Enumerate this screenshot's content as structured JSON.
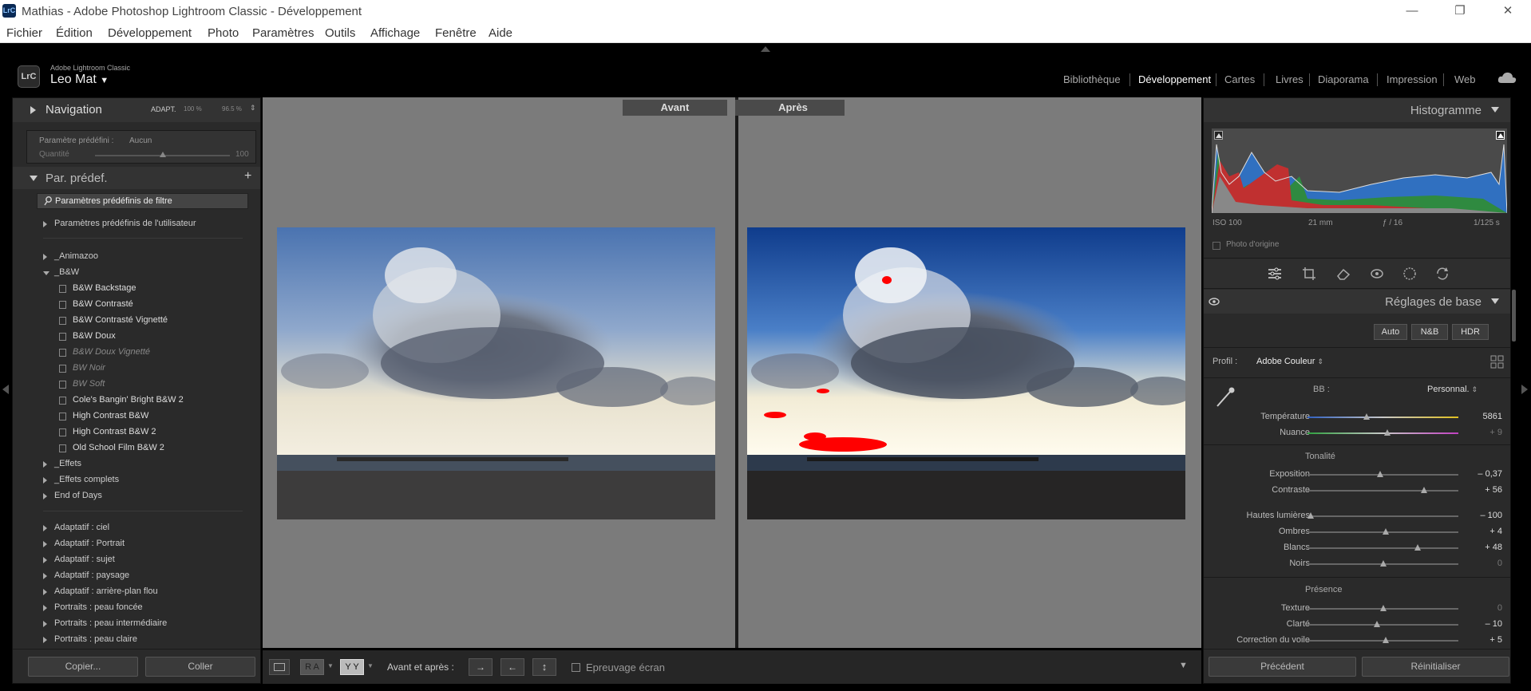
{
  "window": {
    "app_icon": "LrC",
    "title": "Mathias - Adobe Photoshop Lightroom Classic - Développement"
  },
  "menu": [
    "Fichier",
    "Édition",
    "Développement",
    "Photo",
    "Paramètres",
    "Outils",
    "Affichage",
    "Fenêtre",
    "Aide"
  ],
  "identity": {
    "logo": "LrC",
    "app_small": "Adobe Lightroom Classic",
    "user": "Leo Mat"
  },
  "modules": [
    "Bibliothèque",
    "Développement",
    "Cartes",
    "Livres",
    "Diaporama",
    "Impression",
    "Web"
  ],
  "left": {
    "navigation": {
      "title": "Navigation",
      "zoom1": "ADAPT.",
      "zoom2": "100 %",
      "zoom3": "96.5 %"
    },
    "preset_box": {
      "label": "Paramètre prédéfini :",
      "value": "Aucun",
      "amount_label": "Quantité",
      "amount_value": "100",
      "amount_fraction": 0.5
    },
    "presets_title": "Par. prédef.",
    "filter_label": "Paramètres prédéfinis de filtre",
    "user_presets": "Paramètres prédéfinis de l'utilisateur",
    "groups_a": [
      "_Animazoo",
      "_B&W"
    ],
    "bw_items": [
      "B&W Backstage",
      "B&W Contrasté",
      "B&W Contrasté Vignetté",
      "B&W Doux",
      "B&W Doux Vignetté",
      "BW Noir",
      "BW Soft",
      "Cole's Bangin' Bright B&W 2",
      "High Contrast B&W",
      "High Contrast B&W 2",
      "Old School Film B&W 2"
    ],
    "groups_b": [
      "_Effets",
      "_Effets complets",
      "End of Days"
    ],
    "groups_c": [
      "Adaptatif : ciel",
      "Adaptatif : Portrait",
      "Adaptatif : sujet",
      "Adaptatif : paysage",
      "Adaptatif : arrière-plan flou",
      "Portraits : peau foncée",
      "Portraits : peau intermédiaire",
      "Portraits : peau claire"
    ],
    "copy_button": "Copier...",
    "paste_button": "Coller"
  },
  "center": {
    "before": "Avant",
    "after": "Après"
  },
  "toolbar": {
    "ra": "R A",
    "yy": "Y Y",
    "before_after": "Avant et après :",
    "proofing": "Epreuvage écran"
  },
  "right": {
    "histogram_title": "Histogramme",
    "exif": {
      "iso": "ISO 100",
      "focal": "21 mm",
      "aperture": "ƒ / 16",
      "shutter": "1/125 s"
    },
    "original_photo": "Photo d'origine",
    "basic_title": "Réglages de base",
    "auto": "Auto",
    "bw": "N&B",
    "hdr": "HDR",
    "profile_label": "Profil :",
    "profile_value": "Adobe Couleur",
    "wb_label": "BB :",
    "wb_value": "Personnal.",
    "tone_label": "Tonalité",
    "presence_label": "Présence",
    "sliders": [
      {
        "label": "Température",
        "value": "5861",
        "position": 0.39
      },
      {
        "label": "Nuance",
        "value": "+ 9",
        "position": 0.53
      },
      {
        "label": "Exposition",
        "value": "– 0,37",
        "position": 0.48
      },
      {
        "label": "Contraste",
        "value": "+ 56",
        "position": 0.77
      },
      {
        "label": "Hautes lumières",
        "value": "– 100",
        "position": 0.02
      },
      {
        "label": "Ombres",
        "value": "+ 4",
        "position": 0.52
      },
      {
        "label": "Blancs",
        "value": "+ 48",
        "position": 0.73
      },
      {
        "label": "Noirs",
        "value": "0",
        "position": 0.5
      },
      {
        "label": "Texture",
        "value": "0",
        "position": 0.5
      },
      {
        "label": "Clarté",
        "value": "– 10",
        "position": 0.46
      },
      {
        "label": "Correction du voile",
        "value": "+ 5",
        "position": 0.52
      }
    ],
    "previous_button": "Précédent",
    "reset_button": "Réinitialiser"
  }
}
